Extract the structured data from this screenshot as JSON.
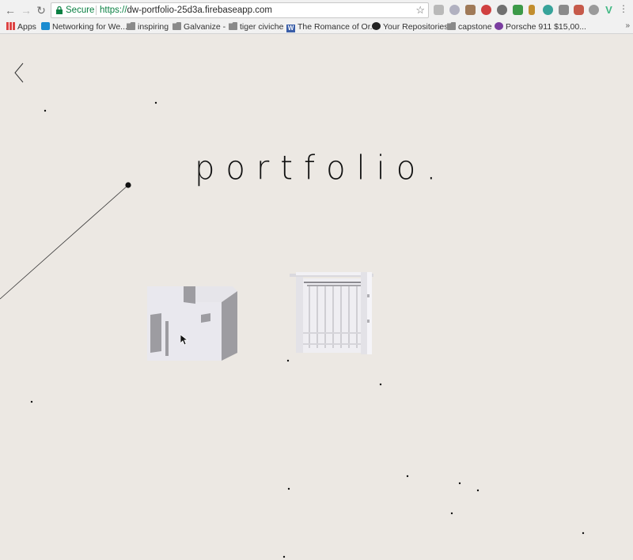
{
  "browser": {
    "security_label": "Secure",
    "url_scheme": "https://",
    "url_host": "dw-portfolio-25d3a.firebaseapp.com",
    "bookmarks": [
      {
        "label": "Apps",
        "icon": "apps-grid-icon"
      },
      {
        "label": "Networking for We...",
        "icon": "udemy-icon"
      },
      {
        "label": "inspiring",
        "icon": "folder-icon"
      },
      {
        "label": "Galvanize -",
        "icon": "folder-icon"
      },
      {
        "label": "tiger civiche",
        "icon": "folder-icon"
      },
      {
        "label": "The Romance of Or...",
        "icon": "wikipedia-icon"
      },
      {
        "label": "Your Repositories",
        "icon": "github-icon"
      },
      {
        "label": "capstone",
        "icon": "folder-icon"
      },
      {
        "label": "Porsche 911 $15,00...",
        "icon": "porsche-icon"
      }
    ],
    "overflow_label": "»"
  },
  "page": {
    "title": "portfolio.",
    "projects": [
      {
        "name": "house-model",
        "icon": "house-3d-model"
      },
      {
        "name": "pavilion-model",
        "icon": "pavilion-3d-model"
      }
    ]
  },
  "colors": {
    "background": "#ece8e3",
    "ink": "#111111",
    "model_light": "#e9e8ee",
    "model_shade": "#9d9ca1"
  }
}
